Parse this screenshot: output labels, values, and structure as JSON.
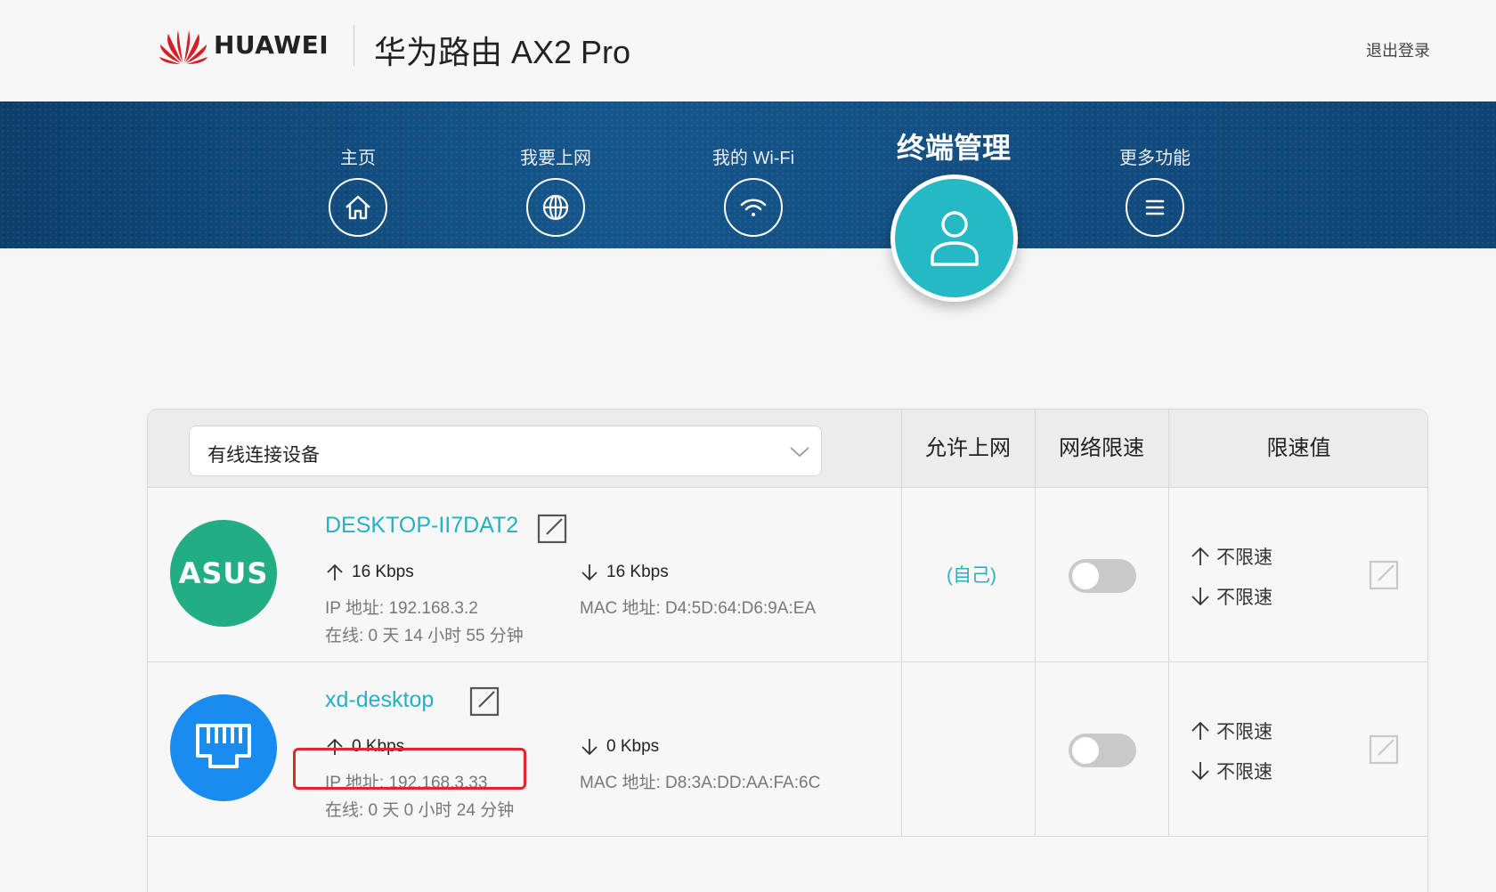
{
  "header": {
    "brand": "HUAWEI",
    "product": "华为路由 AX2 Pro",
    "logout": "退出登录"
  },
  "nav": {
    "items": [
      {
        "label": "主页",
        "icon": "home-icon"
      },
      {
        "label": "我要上网",
        "icon": "globe-icon"
      },
      {
        "label": "我的 Wi-Fi",
        "icon": "wifi-icon"
      },
      {
        "label": "终端管理",
        "icon": "user-icon",
        "active": true
      },
      {
        "label": "更多功能",
        "icon": "menu-icon"
      }
    ]
  },
  "table": {
    "filter": "有线连接设备",
    "columns": {
      "allow": "允许上网",
      "limit": "网络限速",
      "value": "限速值"
    },
    "devices": [
      {
        "avatar": "ASUS",
        "name": "DESKTOP-II7DAT2",
        "up": "16 Kbps",
        "down": "16 Kbps",
        "ip": "IP 地址: 192.168.3.2",
        "mac": "MAC 地址: D4:5D:64:D6:9A:EA",
        "online": "在线: 0 天 14 小时 55 分钟",
        "allow": "(自己)",
        "limit_enabled": false,
        "up_limit": "不限速",
        "down_limit": "不限速"
      },
      {
        "avatar_icon": "ethernet-icon",
        "name": "xd-desktop",
        "up": "0 Kbps",
        "down": "0 Kbps",
        "ip": "IP 地址: 192.168.3.33",
        "mac": "MAC 地址: D8:3A:DD:AA:FA:6C",
        "online": "在线: 0 天 0 小时 24 分钟",
        "allow": "",
        "limit_enabled": false,
        "up_limit": "不限速",
        "down_limit": "不限速"
      }
    ]
  },
  "colors": {
    "accent": "#25b9c6",
    "banner": "#15568c",
    "highlight": "#e3262b"
  }
}
